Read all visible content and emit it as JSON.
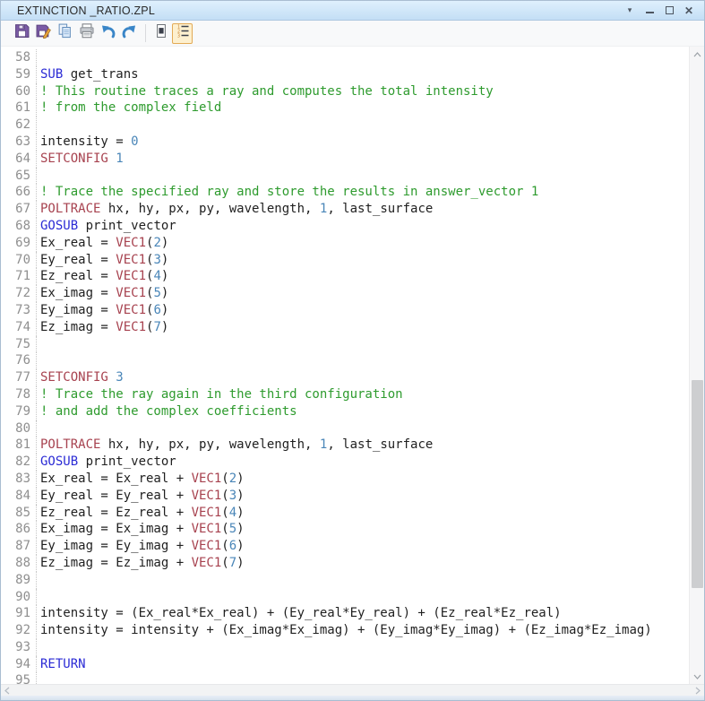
{
  "window": {
    "title": "EXTINCTION _RATIO.ZPL",
    "controls": {
      "menu": "dropdown-caret",
      "minimize": "minimize",
      "maximize": "maximize",
      "close": "close"
    }
  },
  "toolbar": {
    "buttons": [
      {
        "name": "save",
        "icon": "save-icon"
      },
      {
        "name": "save-as",
        "icon": "save-as-icon"
      },
      {
        "name": "copy",
        "icon": "copy-icon"
      },
      {
        "name": "print",
        "icon": "print-icon"
      },
      {
        "name": "undo",
        "icon": "undo-icon"
      },
      {
        "name": "redo",
        "icon": "redo-icon"
      },
      {
        "name": "text-block",
        "icon": "text-block-icon",
        "active": false
      },
      {
        "name": "line-numbers",
        "icon": "line-numbers-icon",
        "active": true
      }
    ]
  },
  "colors": {
    "keyword": "#2b2bd5",
    "command": "#a7424f",
    "comment": "#2e9b2e",
    "number": "#4a86b8",
    "text": "#1f1f1f",
    "line_number": "#8f8f8f",
    "titlebar_top": "#dff0fd",
    "titlebar_bottom": "#c3def5"
  },
  "editor": {
    "first_line": 58,
    "last_line": 95,
    "lines": [
      {
        "n": 58,
        "s": []
      },
      {
        "n": 59,
        "s": [
          [
            "k",
            "SUB"
          ],
          [
            "d",
            " get_trans"
          ]
        ]
      },
      {
        "n": 60,
        "s": [
          [
            "c",
            "! This routine traces a ray and computes the total intensity"
          ]
        ]
      },
      {
        "n": 61,
        "s": [
          [
            "c",
            "! from the complex field"
          ]
        ]
      },
      {
        "n": 62,
        "s": []
      },
      {
        "n": 63,
        "s": [
          [
            "d",
            "intensity = "
          ],
          [
            "n",
            "0"
          ]
        ]
      },
      {
        "n": 64,
        "s": [
          [
            "f",
            "SETCONFIG"
          ],
          [
            "d",
            " "
          ],
          [
            "n",
            "1"
          ]
        ]
      },
      {
        "n": 65,
        "s": []
      },
      {
        "n": 66,
        "s": [
          [
            "c",
            "! Trace the specified ray and store the results in answer_vector 1"
          ]
        ]
      },
      {
        "n": 67,
        "s": [
          [
            "f",
            "POLTRACE"
          ],
          [
            "d",
            " hx, hy, px, py, wavelength, "
          ],
          [
            "n",
            "1"
          ],
          [
            "d",
            ", last_surface"
          ]
        ]
      },
      {
        "n": 68,
        "s": [
          [
            "k",
            "GOSUB"
          ],
          [
            "d",
            " print_vector"
          ]
        ]
      },
      {
        "n": 69,
        "s": [
          [
            "d",
            "Ex_real = "
          ],
          [
            "f",
            "VEC1"
          ],
          [
            "d",
            "("
          ],
          [
            "n",
            "2"
          ],
          [
            "d",
            ")"
          ]
        ]
      },
      {
        "n": 70,
        "s": [
          [
            "d",
            "Ey_real = "
          ],
          [
            "f",
            "VEC1"
          ],
          [
            "d",
            "("
          ],
          [
            "n",
            "3"
          ],
          [
            "d",
            ")"
          ]
        ]
      },
      {
        "n": 71,
        "s": [
          [
            "d",
            "Ez_real = "
          ],
          [
            "f",
            "VEC1"
          ],
          [
            "d",
            "("
          ],
          [
            "n",
            "4"
          ],
          [
            "d",
            ")"
          ]
        ]
      },
      {
        "n": 72,
        "s": [
          [
            "d",
            "Ex_imag = "
          ],
          [
            "f",
            "VEC1"
          ],
          [
            "d",
            "("
          ],
          [
            "n",
            "5"
          ],
          [
            "d",
            ")"
          ]
        ]
      },
      {
        "n": 73,
        "s": [
          [
            "d",
            "Ey_imag = "
          ],
          [
            "f",
            "VEC1"
          ],
          [
            "d",
            "("
          ],
          [
            "n",
            "6"
          ],
          [
            "d",
            ")"
          ]
        ]
      },
      {
        "n": 74,
        "s": [
          [
            "d",
            "Ez_imag = "
          ],
          [
            "f",
            "VEC1"
          ],
          [
            "d",
            "("
          ],
          [
            "n",
            "7"
          ],
          [
            "d",
            ")"
          ]
        ]
      },
      {
        "n": 75,
        "s": []
      },
      {
        "n": 76,
        "s": []
      },
      {
        "n": 77,
        "s": [
          [
            "f",
            "SETCONFIG"
          ],
          [
            "d",
            " "
          ],
          [
            "n",
            "3"
          ]
        ]
      },
      {
        "n": 78,
        "s": [
          [
            "c",
            "! Trace the ray again in the third configuration"
          ]
        ]
      },
      {
        "n": 79,
        "s": [
          [
            "c",
            "! and add the complex coefficients"
          ]
        ]
      },
      {
        "n": 80,
        "s": []
      },
      {
        "n": 81,
        "s": [
          [
            "f",
            "POLTRACE"
          ],
          [
            "d",
            " hx, hy, px, py, wavelength, "
          ],
          [
            "n",
            "1"
          ],
          [
            "d",
            ", last_surface"
          ]
        ]
      },
      {
        "n": 82,
        "s": [
          [
            "k",
            "GOSUB"
          ],
          [
            "d",
            " print_vector"
          ]
        ]
      },
      {
        "n": 83,
        "s": [
          [
            "d",
            "Ex_real = Ex_real + "
          ],
          [
            "f",
            "VEC1"
          ],
          [
            "d",
            "("
          ],
          [
            "n",
            "2"
          ],
          [
            "d",
            ")"
          ]
        ]
      },
      {
        "n": 84,
        "s": [
          [
            "d",
            "Ey_real = Ey_real + "
          ],
          [
            "f",
            "VEC1"
          ],
          [
            "d",
            "("
          ],
          [
            "n",
            "3"
          ],
          [
            "d",
            ")"
          ]
        ]
      },
      {
        "n": 85,
        "s": [
          [
            "d",
            "Ez_real = Ez_real + "
          ],
          [
            "f",
            "VEC1"
          ],
          [
            "d",
            "("
          ],
          [
            "n",
            "4"
          ],
          [
            "d",
            ")"
          ]
        ]
      },
      {
        "n": 86,
        "s": [
          [
            "d",
            "Ex_imag = Ex_imag + "
          ],
          [
            "f",
            "VEC1"
          ],
          [
            "d",
            "("
          ],
          [
            "n",
            "5"
          ],
          [
            "d",
            ")"
          ]
        ]
      },
      {
        "n": 87,
        "s": [
          [
            "d",
            "Ey_imag = Ey_imag + "
          ],
          [
            "f",
            "VEC1"
          ],
          [
            "d",
            "("
          ],
          [
            "n",
            "6"
          ],
          [
            "d",
            ")"
          ]
        ]
      },
      {
        "n": 88,
        "s": [
          [
            "d",
            "Ez_imag = Ez_imag + "
          ],
          [
            "f",
            "VEC1"
          ],
          [
            "d",
            "("
          ],
          [
            "n",
            "7"
          ],
          [
            "d",
            ")"
          ]
        ]
      },
      {
        "n": 89,
        "s": []
      },
      {
        "n": 90,
        "s": []
      },
      {
        "n": 91,
        "s": [
          [
            "d",
            "intensity = (Ex_real*Ex_real) + (Ey_real*Ey_real) + (Ez_real*Ez_real)"
          ]
        ]
      },
      {
        "n": 92,
        "s": [
          [
            "d",
            "intensity = intensity + (Ex_imag*Ex_imag) + (Ey_imag*Ey_imag) + (Ez_imag*Ez_imag)"
          ]
        ]
      },
      {
        "n": 93,
        "s": []
      },
      {
        "n": 94,
        "s": [
          [
            "k",
            "RETURN"
          ]
        ]
      },
      {
        "n": 95,
        "s": []
      }
    ]
  }
}
